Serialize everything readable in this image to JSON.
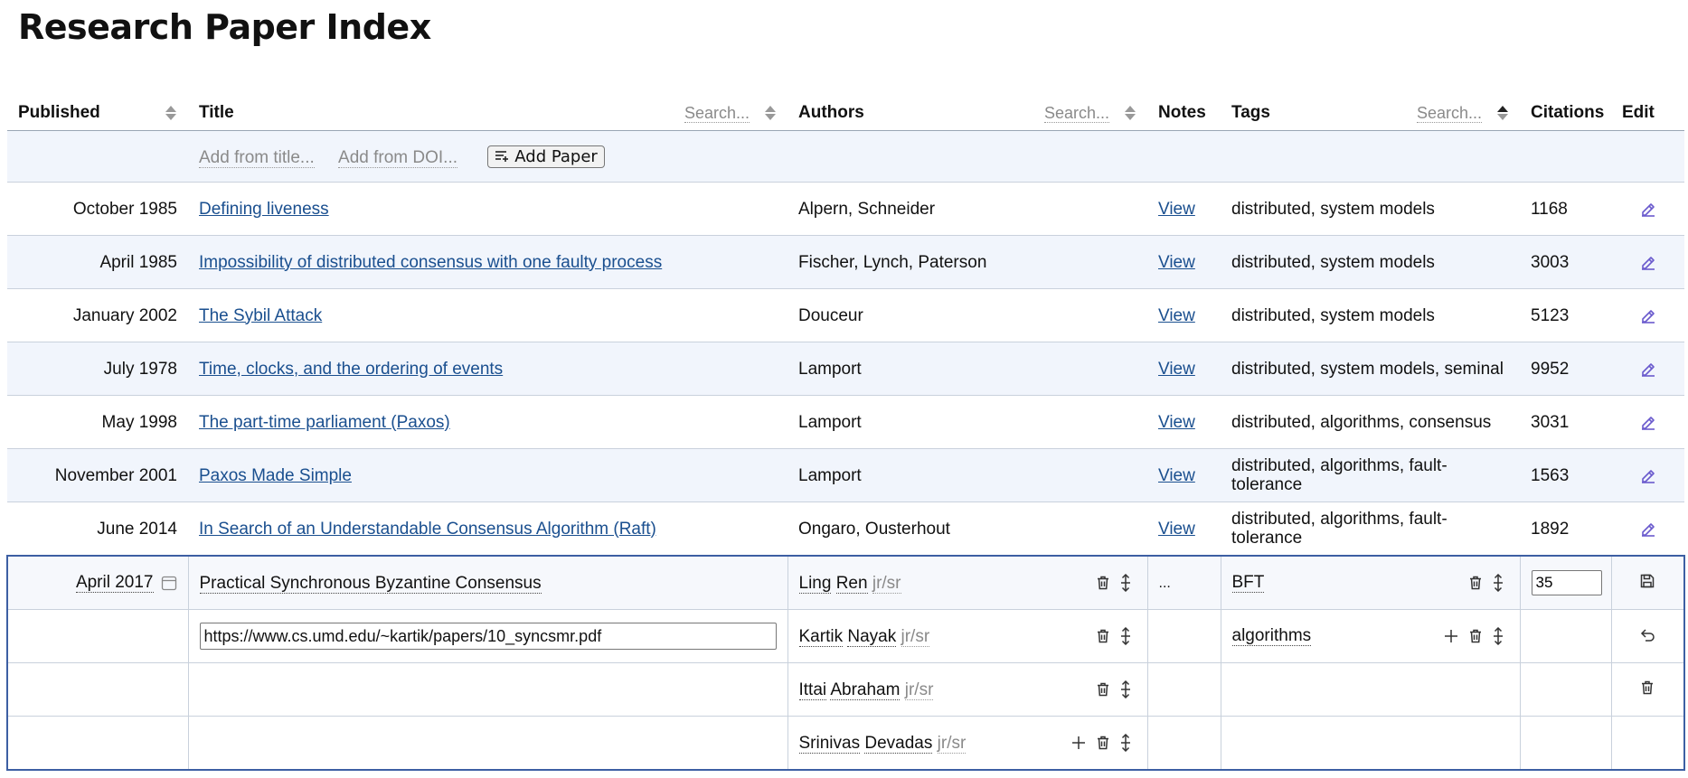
{
  "page_title": "Research Paper Index",
  "columns": {
    "published": "Published",
    "title": "Title",
    "authors": "Authors",
    "notes": "Notes",
    "tags": "Tags",
    "citations": "Citations",
    "edit": "Edit"
  },
  "search": {
    "title_placeholder": "Search...",
    "authors_placeholder": "Search...",
    "tags_placeholder": "Search..."
  },
  "add_row": {
    "from_title": "Add from title...",
    "from_doi": "Add from DOI...",
    "add_button": "Add Paper"
  },
  "papers": [
    {
      "published": "October 1985",
      "title": "Defining liveness",
      "authors": "Alpern, Schneider",
      "notes": "View",
      "tags": "distributed, system models",
      "citations": "1168"
    },
    {
      "published": "April 1985",
      "title": "Impossibility of distributed consensus with one faulty process",
      "authors": "Fischer, Lynch, Paterson",
      "notes": "View",
      "tags": "distributed, system models",
      "citations": "3003"
    },
    {
      "published": "January 2002",
      "title": "The Sybil Attack",
      "authors": "Douceur",
      "notes": "View",
      "tags": "distributed, system models",
      "citations": "5123"
    },
    {
      "published": "July 1978",
      "title": "Time, clocks, and the ordering of events",
      "authors": "Lamport",
      "notes": "View",
      "tags": "distributed, system models, seminal",
      "citations": "9952"
    },
    {
      "published": "May 1998",
      "title": "The part-time parliament (Paxos)",
      "authors": "Lamport",
      "notes": "View",
      "tags": "distributed, algorithms, consensus",
      "citations": "3031"
    },
    {
      "published": "November 2001",
      "title": "Paxos Made Simple",
      "authors": "Lamport",
      "notes": "View",
      "tags": "distributed, algorithms, fault-tolerance",
      "citations": "1563"
    },
    {
      "published": "June 2014",
      "title": "In Search of an Understandable Consensus Algorithm (Raft)",
      "authors": "Ongaro, Ousterhout",
      "notes": "View",
      "tags": "distributed, algorithms, fault-tolerance",
      "citations": "1892"
    }
  ],
  "editing": {
    "published": "April 2017",
    "title": "Practical Synchronous Byzantine Consensus",
    "url": "https://www.cs.umd.edu/~kartik/papers/10_syncsmr.pdf",
    "authors": [
      {
        "first": "Ling",
        "last": "Ren",
        "suffix": "jr/sr"
      },
      {
        "first": "Kartik",
        "last": "Nayak",
        "suffix": "jr/sr"
      },
      {
        "first": "Ittai",
        "last": "Abraham",
        "suffix": "jr/sr"
      },
      {
        "first": "Srinivas",
        "last": "Devadas",
        "suffix": "jr/sr"
      }
    ],
    "notes": "...",
    "tags": [
      "BFT",
      "algorithms"
    ],
    "citations": "35"
  },
  "colors": {
    "accent": "#3d5fa3",
    "link": "#1a4f8f",
    "stripe": "#f1f5fc",
    "icon": "#6a5acd"
  }
}
